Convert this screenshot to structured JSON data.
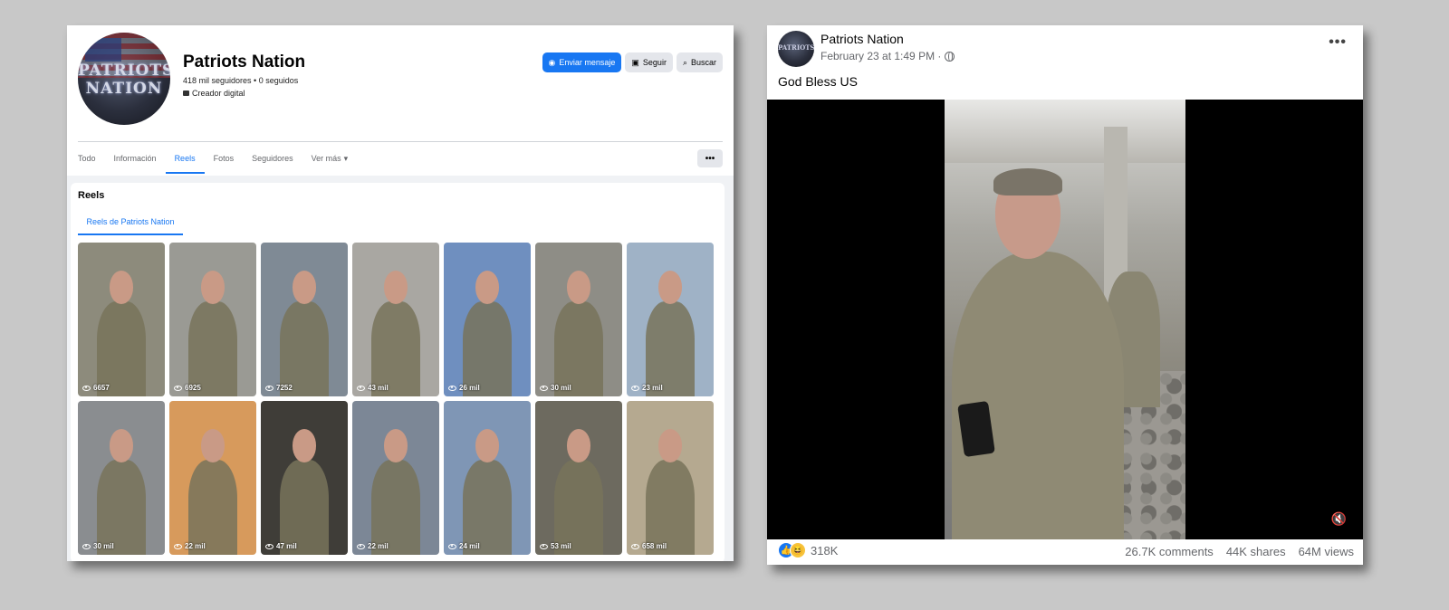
{
  "left": {
    "page": {
      "name": "Patriots Nation",
      "stats": "418 mil seguidores • 0 seguidos",
      "category": "Creador digital",
      "avatar_text_1": "PATRIOTS",
      "avatar_text_2": "NATION"
    },
    "actions": {
      "message_label": "Enviar mensaje",
      "message_icon": "messenger-icon",
      "follow_label": "Seguir",
      "follow_icon": "follow-icon",
      "search_label": "Buscar",
      "search_icon": "search-icon"
    },
    "tabs": [
      {
        "label": "Todo",
        "active": false
      },
      {
        "label": "Información",
        "active": false
      },
      {
        "label": "Reels",
        "active": true
      },
      {
        "label": "Fotos",
        "active": false
      },
      {
        "label": "Seguidores",
        "active": false
      },
      {
        "label": "Ver más",
        "active": false
      }
    ],
    "more_button": "•••",
    "reels": {
      "title": "Reels",
      "subtab": "Reels de Patriots Nation",
      "items": [
        {
          "views": "6657",
          "bg": "#8d8b7c"
        },
        {
          "views": "6925",
          "bg": "#9a9a94"
        },
        {
          "views": "7252",
          "bg": "#7f8a95"
        },
        {
          "views": "43 mil",
          "bg": "#a9a7a2"
        },
        {
          "views": "26 mil",
          "bg": "#6f8fbf"
        },
        {
          "views": "30 mil",
          "bg": "#8e8d86"
        },
        {
          "views": "23 mil",
          "bg": "#9fb2c6"
        },
        {
          "views": "30 mil",
          "bg": "#8a8d90"
        },
        {
          "views": "22 mil",
          "bg": "#d79a5c"
        },
        {
          "views": "47 mil",
          "bg": "#3f3d38"
        },
        {
          "views": "22 mil",
          "bg": "#7c8796"
        },
        {
          "views": "24 mil",
          "bg": "#7f96b5"
        },
        {
          "views": "53 mil",
          "bg": "#6d6a5f"
        },
        {
          "views": "658 mil",
          "bg": "#b5a990"
        }
      ]
    }
  },
  "right": {
    "author": "Patriots Nation",
    "avatar_text": "PATRIOTS",
    "date": "February 23 at 1:49 PM ·",
    "privacy_icon": "globe-icon",
    "options": "•••",
    "text": "God Bless US",
    "mute_glyph": "🔇",
    "reactions": {
      "like_glyph": "👍",
      "haha_glyph": "😆",
      "count": "318K"
    },
    "comments": "26.7K comments",
    "shares": "44K shares",
    "views": "64M views"
  }
}
